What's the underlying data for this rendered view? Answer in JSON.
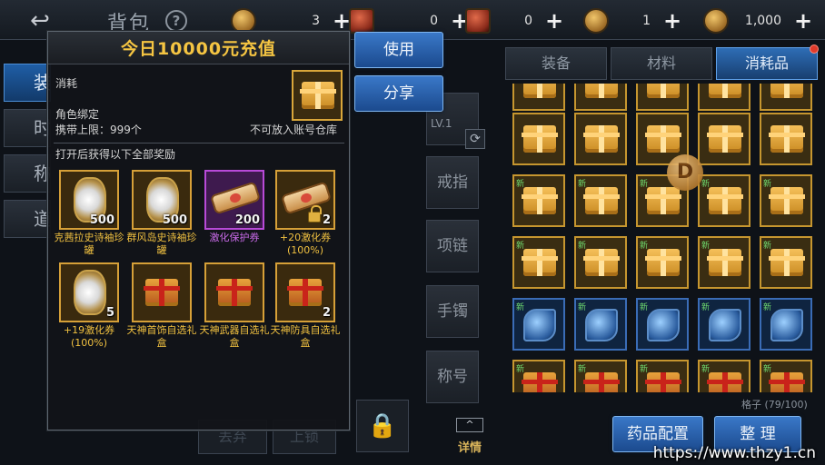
{
  "header": {
    "title": "背包",
    "help_icon": "?",
    "back_icon": "↩",
    "currencies": [
      {
        "icon": "coin-icon",
        "value": "3"
      },
      {
        "icon": "ticket-icon",
        "value": "0"
      },
      {
        "icon": "ticket-icon",
        "value": "0"
      },
      {
        "icon": "coin-icon",
        "value": "1"
      },
      {
        "icon": "coin-icon",
        "value": "1,000"
      }
    ],
    "add_label": "+"
  },
  "side_tabs": [
    "装",
    "时",
    "称",
    "道"
  ],
  "equip_slots": [
    "戒指",
    "项链",
    "手镯",
    "称号"
  ],
  "weapon_level": "LV.1",
  "detail_button": {
    "label": "详情",
    "arrow": "^"
  },
  "ghost_buttons": [
    "丢弃",
    "上锁"
  ],
  "inventory": {
    "tabs": [
      "装备",
      "材料",
      "消耗品"
    ],
    "active_tab": 2,
    "capacity": "格子 (79/100)",
    "new_tag": "新"
  },
  "bottom_buttons": {
    "potion": "药品配置",
    "sort": "整 理"
  },
  "popup": {
    "title": "今日10000元充值",
    "type": "消耗",
    "bind": "角色绑定",
    "carry_limit": "携带上限：999个",
    "no_store": "不可放入账号仓库",
    "open_hint": "打开后获得以下全部奖励",
    "rewards": [
      {
        "name": "克茜拉史诗袖珍罐",
        "count": "500",
        "icon": "vase-icon",
        "rarity": "gold"
      },
      {
        "name": "群风岛史诗袖珍罐",
        "count": "500",
        "icon": "vase-icon",
        "rarity": "gold"
      },
      {
        "name": "激化保护券",
        "count": "200",
        "icon": "scroll-icon",
        "rarity": "purple"
      },
      {
        "name": "+20激化券(100%)",
        "count": "2",
        "icon": "scroll-icon",
        "rarity": "gold"
      },
      {
        "name": "+19激化券(100%)",
        "count": "5",
        "icon": "vase-icon",
        "rarity": "gold"
      },
      {
        "name": "天神首饰自选礼盒",
        "count": "",
        "icon": "gift-box-icon",
        "rarity": "gold"
      },
      {
        "name": "天神武器自选礼盒",
        "count": "",
        "icon": "gift-box-icon",
        "rarity": "gold"
      },
      {
        "name": "天神防具自选礼盒",
        "count": "2",
        "icon": "gift-box-icon",
        "rarity": "gold"
      }
    ]
  },
  "actions": {
    "use": "使用",
    "share": "分享"
  },
  "watermark": "https://www.thzy1.cn",
  "colors": {
    "gold": "#f5c542",
    "purple": "#c86ae8",
    "blue_button": "#2a62aa"
  }
}
